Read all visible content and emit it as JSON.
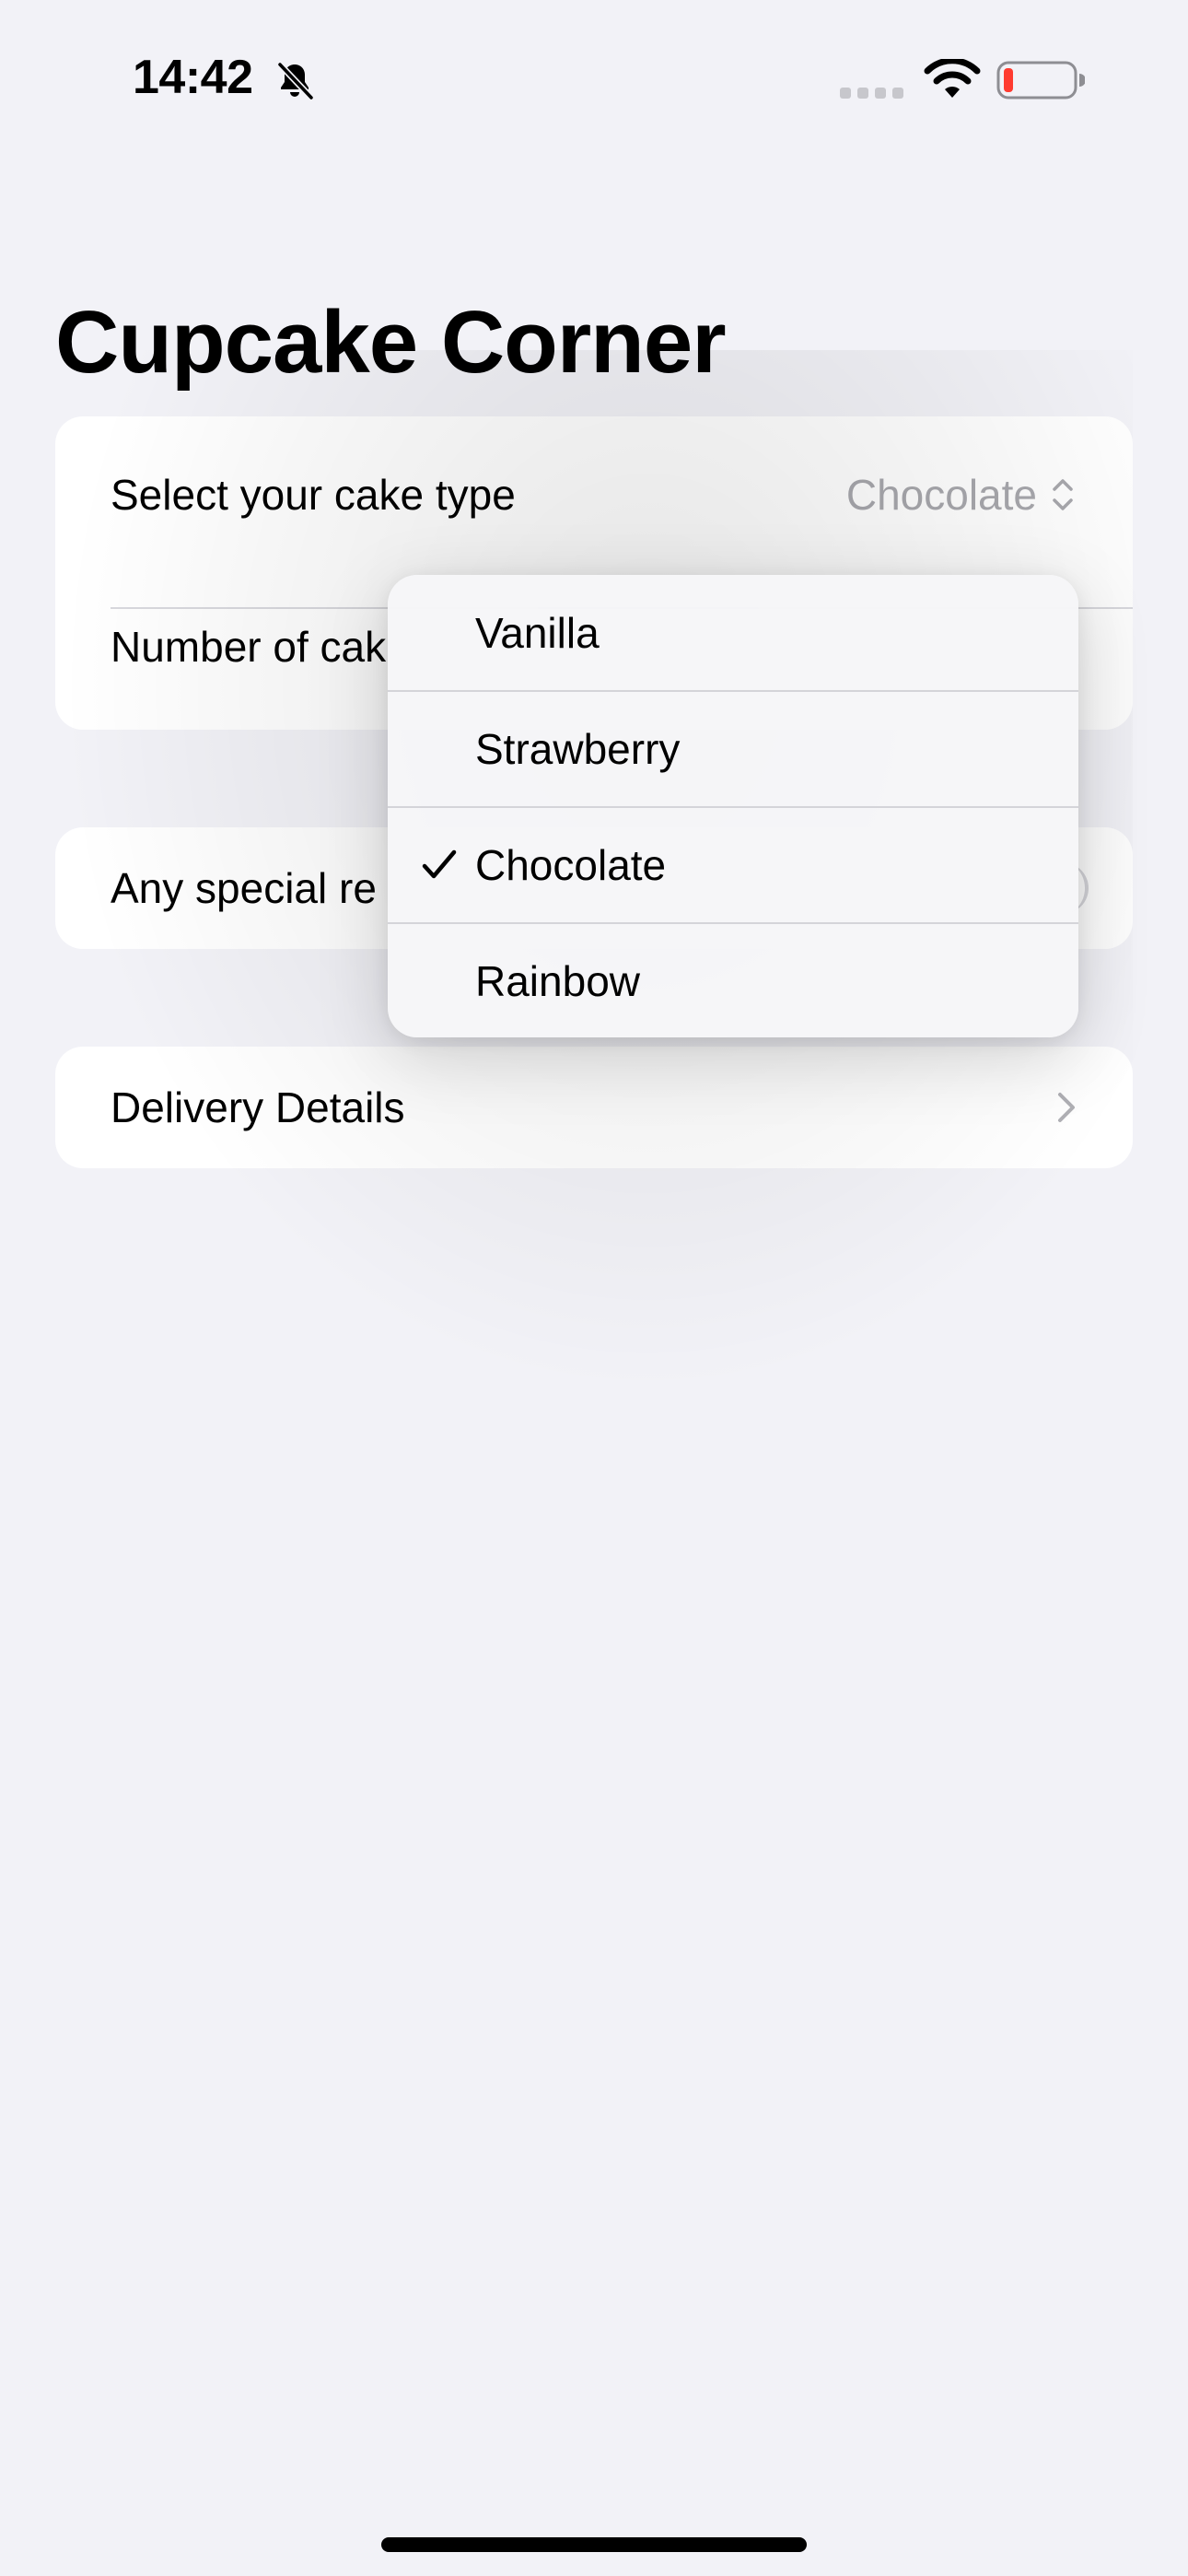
{
  "status_bar": {
    "time": "14:42",
    "icons": [
      "bell-slash-icon",
      "signal-icon",
      "wifi-icon",
      "battery-low-icon"
    ],
    "battery_color": "#ff3b30"
  },
  "page": {
    "title": "Cupcake Corner"
  },
  "form": {
    "cake_type_label": "Select your cake type",
    "cake_type_value": "Chocolate",
    "cake_count_label": "Number of cak",
    "special_requests_label": "Any special re",
    "delivery_label": "Delivery Details"
  },
  "picker_menu": {
    "options": [
      {
        "label": "Vanilla",
        "selected": false
      },
      {
        "label": "Strawberry",
        "selected": false
      },
      {
        "label": "Chocolate",
        "selected": true
      },
      {
        "label": "Rainbow",
        "selected": false
      }
    ]
  },
  "colors": {
    "background": "#f2f2f7",
    "card": "#ffffff",
    "secondary_text": "#a8a8ad",
    "separator": "#d9d9de"
  }
}
